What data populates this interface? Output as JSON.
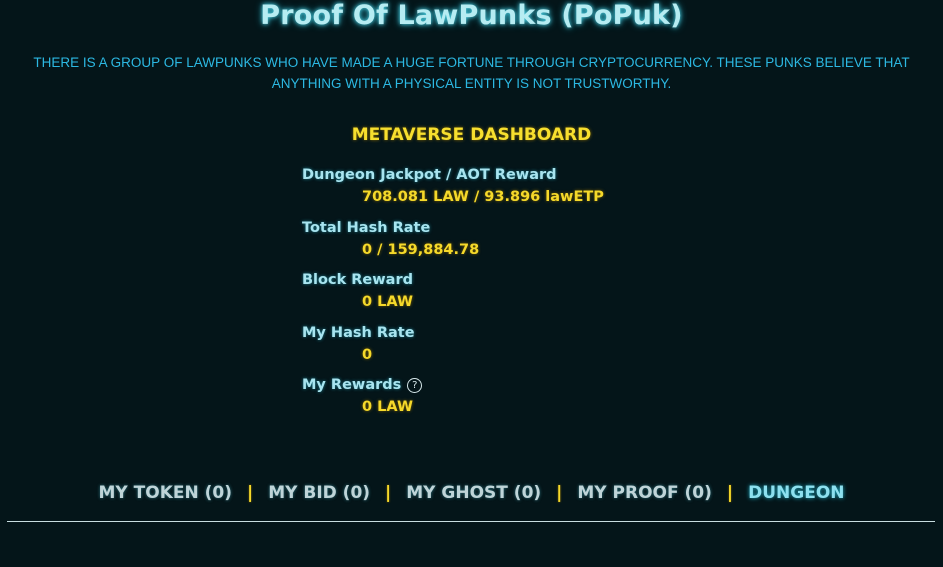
{
  "header": {
    "title": "Proof Of LawPunks (PoPuk)",
    "intro": "THERE IS A GROUP OF LAWPUNKS WHO HAVE MADE A HUGE FORTUNE THROUGH CRYPTOCURRENCY. THESE PUNKS BELIEVE THAT ANYTHING WITH A PHYSICAL ENTITY IS NOT TRUSTWORTHY."
  },
  "dashboard": {
    "title": "METAVERSE DASHBOARD",
    "stats": [
      {
        "label": "Dungeon Jackpot / AOT Reward",
        "value": "708.081 LAW / 93.896 lawETP"
      },
      {
        "label": "Total Hash Rate",
        "value": "0 / 159,884.78"
      },
      {
        "label": "Block Reward",
        "value": "0 LAW"
      },
      {
        "label": "My Hash Rate",
        "value": "0"
      },
      {
        "label": "My Rewards",
        "value": "0 LAW",
        "icon": "help-circle-icon"
      }
    ]
  },
  "nav": {
    "separator": "|",
    "items": [
      {
        "label": "MY TOKEN (0)"
      },
      {
        "label": "MY BID (0)"
      },
      {
        "label": "MY GHOST (0)"
      },
      {
        "label": "MY PROOF (0)"
      },
      {
        "label": "DUNGEON",
        "active": true
      }
    ]
  },
  "colors": {
    "background": "#041519",
    "title": "#b6ecf2",
    "intro": "#2cb8e2",
    "accent_yellow": "#f5d92a",
    "label_cyan": "#a8e4ef",
    "nav_text": "#bfd4d8",
    "nav_active": "#8de0ef"
  }
}
